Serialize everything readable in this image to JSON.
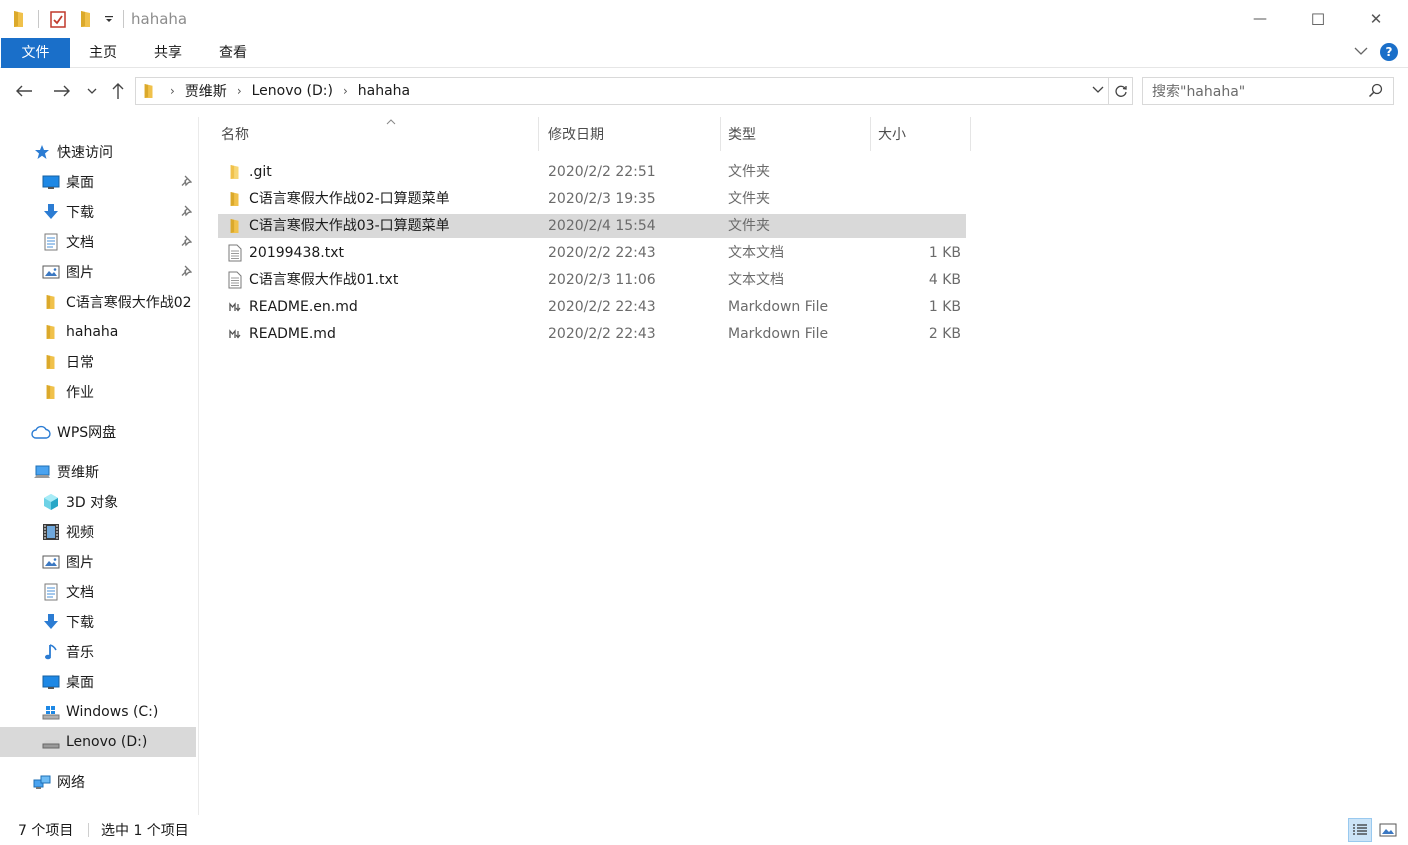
{
  "window": {
    "title": "hahaha",
    "minimize_glyph": "—",
    "maximize_glyph": "☐",
    "close_glyph": "✕"
  },
  "ribbon": {
    "tabs": [
      "文件",
      "主页",
      "共享",
      "查看"
    ],
    "active_tab": "文件",
    "accent_color": "#1a6fc9",
    "help_glyph": "?"
  },
  "address": {
    "crumbs": [
      "贾维斯",
      "Lenovo (D:)",
      "hahaha"
    ],
    "search_placeholder": "搜索\"hahaha\""
  },
  "sidebar": {
    "quick_access": "快速访问",
    "quick_items": [
      {
        "label": "桌面",
        "icon": "desktop-icon",
        "pinned": true
      },
      {
        "label": "下载",
        "icon": "download-icon",
        "pinned": true
      },
      {
        "label": "文档",
        "icon": "document-icon",
        "pinned": true
      },
      {
        "label": "图片",
        "icon": "pictures-icon",
        "pinned": true
      },
      {
        "label": "C语言寒假大作战02",
        "icon": "folder-icon",
        "pinned": false
      },
      {
        "label": "hahaha",
        "icon": "folder-icon",
        "pinned": false
      },
      {
        "label": "日常",
        "icon": "folder-icon",
        "pinned": false
      },
      {
        "label": "作业",
        "icon": "folder-icon",
        "pinned": false
      }
    ],
    "wps": "WPS网盘",
    "pc": "贾维斯",
    "pc_items": [
      {
        "label": "3D 对象",
        "icon": "3d-objects-icon"
      },
      {
        "label": "视频",
        "icon": "videos-icon"
      },
      {
        "label": "图片",
        "icon": "pictures-icon"
      },
      {
        "label": "文档",
        "icon": "document-icon"
      },
      {
        "label": "下载",
        "icon": "download-icon"
      },
      {
        "label": "音乐",
        "icon": "music-icon"
      },
      {
        "label": "桌面",
        "icon": "desktop-icon"
      },
      {
        "label": "Windows (C:)",
        "icon": "windows-drive-icon"
      },
      {
        "label": "Lenovo (D:)",
        "icon": "drive-icon",
        "selected": true
      }
    ],
    "network": "网络"
  },
  "columns": {
    "name": "名称",
    "date": "修改日期",
    "type": "类型",
    "size": "大小"
  },
  "files": [
    {
      "name": ".git",
      "date": "2020/2/2 22:51",
      "type": "文件夹",
      "size": "",
      "icon": "folder-icon"
    },
    {
      "name": "C语言寒假大作战02-口算题菜单",
      "date": "2020/2/3 19:35",
      "type": "文件夹",
      "size": "",
      "icon": "folder-icon"
    },
    {
      "name": "C语言寒假大作战03-口算题菜单",
      "date": "2020/2/4 15:54",
      "type": "文件夹",
      "size": "",
      "icon": "folder-icon",
      "selected": true
    },
    {
      "name": "20199438.txt",
      "date": "2020/2/2 22:43",
      "type": "文本文档",
      "size": "1 KB",
      "icon": "text-file-icon"
    },
    {
      "name": "C语言寒假大作战01.txt",
      "date": "2020/2/3 11:06",
      "type": "文本文档",
      "size": "4 KB",
      "icon": "text-file-icon"
    },
    {
      "name": "README.en.md",
      "date": "2020/2/2 22:43",
      "type": "Markdown File",
      "size": "1 KB",
      "icon": "markdown-file-icon"
    },
    {
      "name": "README.md",
      "date": "2020/2/2 22:43",
      "type": "Markdown File",
      "size": "2 KB",
      "icon": "markdown-file-icon"
    }
  ],
  "status": {
    "count": "7 个项目",
    "selected": "选中 1 个项目"
  }
}
